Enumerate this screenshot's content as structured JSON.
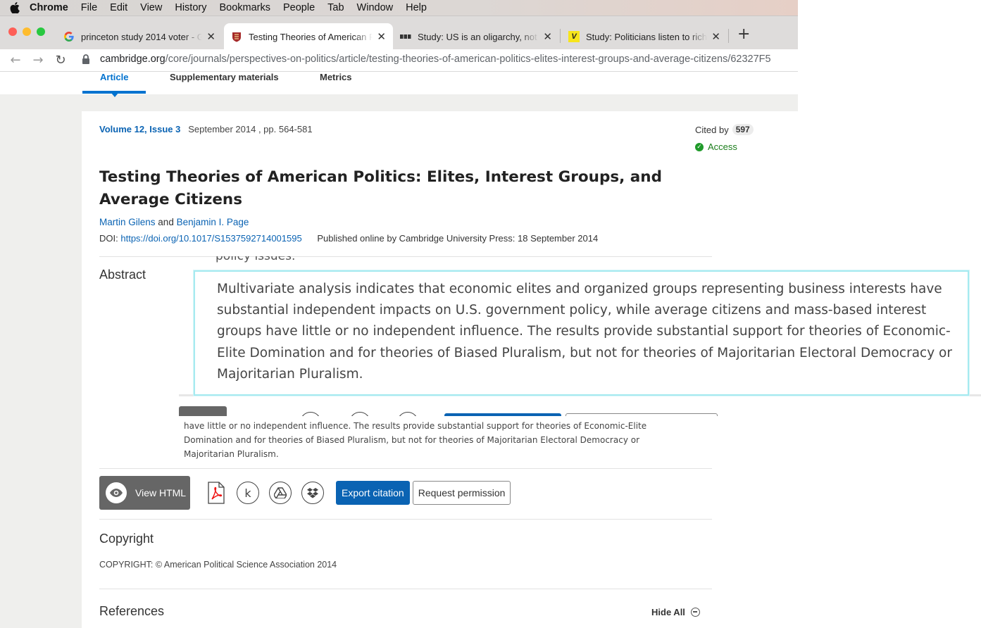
{
  "menubar": {
    "app": "Chrome",
    "items": [
      "File",
      "Edit",
      "View",
      "History",
      "Bookmarks",
      "People",
      "Tab",
      "Window",
      "Help"
    ]
  },
  "tabs": [
    {
      "title": "princeton study 2014 voter - G",
      "favicon": "google-icon"
    },
    {
      "title": "Testing Theories of American P",
      "favicon": "cambridge-shield-icon"
    },
    {
      "title": "Study: US is an oligarchy, not a",
      "favicon": "bbc-icon"
    },
    {
      "title": "Study: Politicians listen to rich",
      "favicon": "vox-icon"
    }
  ],
  "address": {
    "domain": "cambridge.org",
    "path": "/core/journals/perspectives-on-politics/article/testing-theories-of-american-politics-elites-interest-groups-and-average-citizens/62327F5"
  },
  "subnav": {
    "article": "Article",
    "supplementary": "Supplementary materials",
    "metrics": "Metrics"
  },
  "article": {
    "volume_link": "Volume 12, Issue 3",
    "volume_rest": "September 2014 , pp. 564-581",
    "cited_label": "Cited by",
    "cited_count": "597",
    "access": "Access",
    "title": "Testing Theories of American Politics: Elites, Interest Groups, and Average Citizens",
    "author1": "Martin Gilens",
    "and": "and",
    "author2": "Benjamin I. Page",
    "doi_label": "DOI:",
    "doi_link": "https://doi.org/10.1017/S1537592714001595",
    "published": "Published online by Cambridge University Press: 18 September 2014"
  },
  "abstract": {
    "heading": "Abstract",
    "peek": "policy issues.",
    "text": "have little or no independent influence. The results provide substantial support for theories of Economic-Elite Domination and for theories of Biased Pluralism, but not for theories of Majoritarian Electoral Democracy or Majoritarian Pluralism.",
    "zoom_text": "Multivariate analysis indicates that economic elites and organized groups representing business interests have substantial independent impacts on U.S. government policy, while average citizens and mass-based interest groups have little or no independent influence. The results provide substantial support for theories of Economic-Elite Domination and for theories of Biased Pluralism, but not for theories of Majoritarian Electoral Democracy or Majoritarian Pluralism."
  },
  "tools": {
    "view_html": "View HTML",
    "kindle": "k",
    "export": "Export citation",
    "request": "Request permission"
  },
  "copyright": {
    "heading": "Copyright",
    "text": "COPYRIGHT: © American Political Science Association 2014"
  },
  "references": {
    "heading": "References",
    "hide_all": "Hide All"
  },
  "colors": {
    "link": "#0a63b3",
    "access_green": "#1f9a2a",
    "zoom_border": "#a6eaf0"
  }
}
